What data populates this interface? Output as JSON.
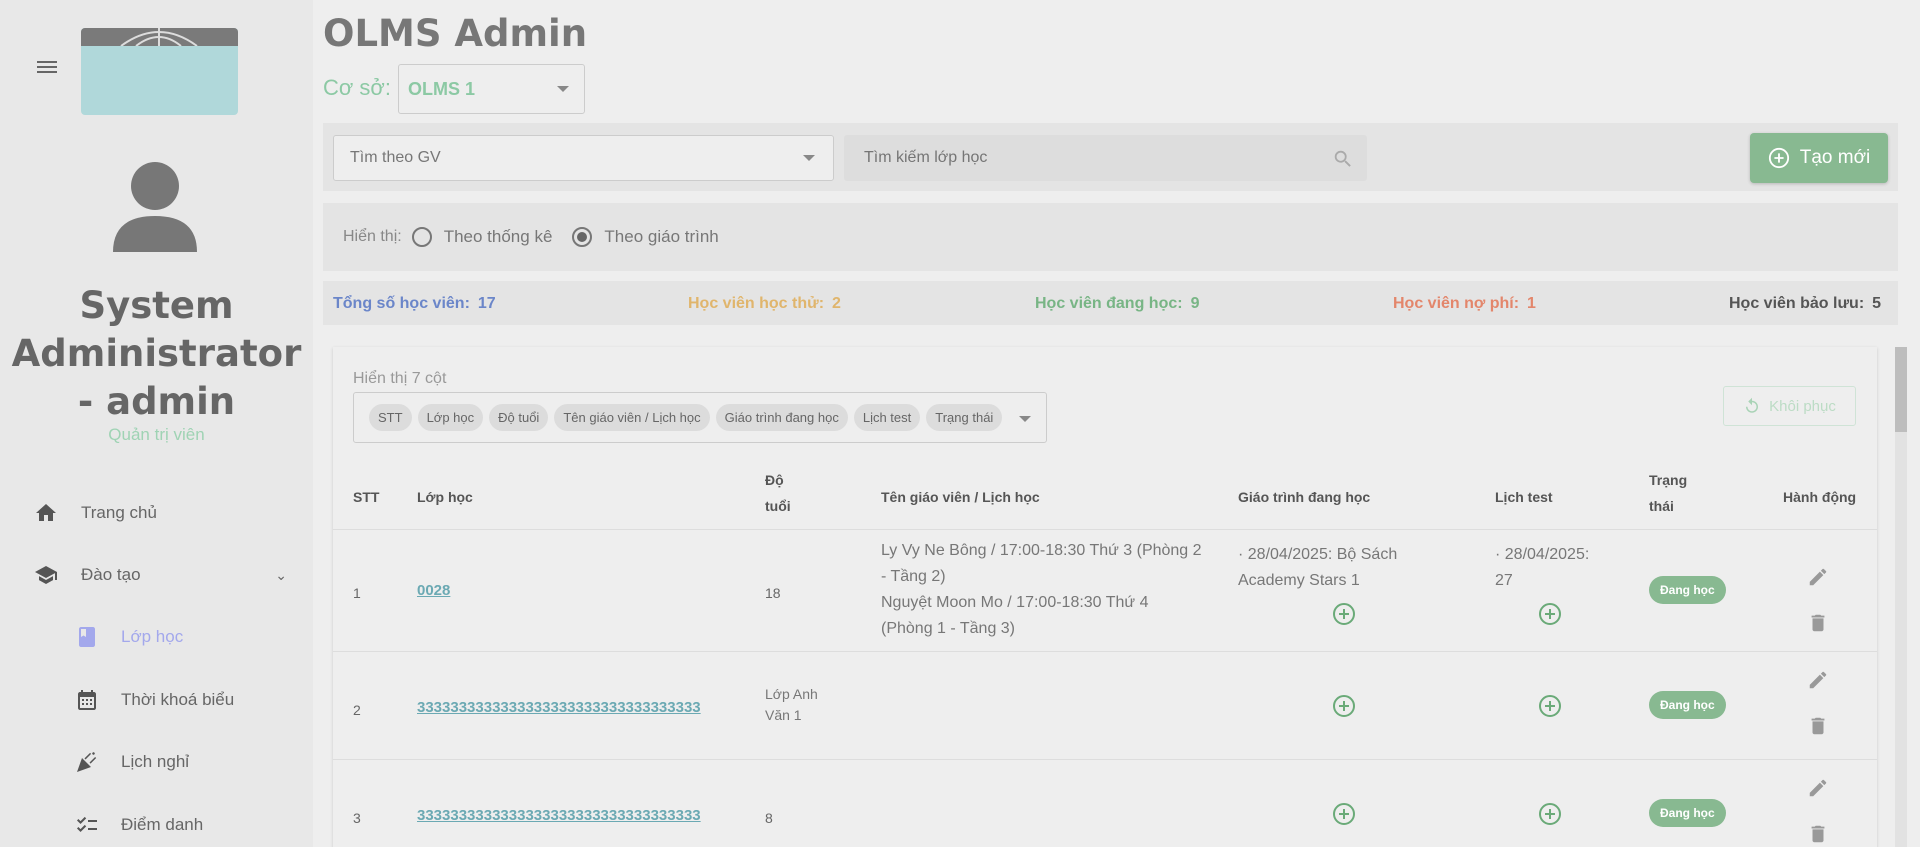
{
  "sidebar": {
    "user_name": "System Administrator - admin",
    "user_role": "Quản trị viên",
    "items": [
      {
        "label": "Trang chủ",
        "icon": "home-icon"
      },
      {
        "label": "Đào tạo",
        "icon": "school-icon"
      },
      {
        "label": "Lớp học",
        "icon": "book-icon"
      },
      {
        "label": "Thời khoá biểu",
        "icon": "calendar-icon"
      },
      {
        "label": "Lịch nghỉ",
        "icon": "party-icon"
      },
      {
        "label": "Điểm danh",
        "icon": "checklist-icon"
      }
    ]
  },
  "header": {
    "title": "OLMS Admin",
    "branch_label": "Cơ sở:",
    "branch_value": "OLMS 1"
  },
  "filters": {
    "teacher_placeholder": "Tìm theo GV",
    "search_placeholder": "Tìm kiếm lớp học",
    "create_label": "Tạo mới"
  },
  "view": {
    "label": "Hiển thị:",
    "option_stats": "Theo thống kê",
    "option_curriculum": "Theo giáo trình",
    "selected": "Theo giáo trình"
  },
  "stats": {
    "total_label": "Tổng số học viên:",
    "total": "17",
    "total_color": "#6b86c9",
    "trial_label": "Học viên học thử:",
    "trial": "2",
    "trial_color": "#e0b56c",
    "studying_label": "Học viên đang học:",
    "studying": "9",
    "studying_color": "#78b585",
    "debt_label": "Học viên nợ phí:",
    "debt": "1",
    "debt_color": "#e3866b",
    "reserved_label": "Học viên bảo lưu:",
    "reserved": "5",
    "reserved_color": "#555555"
  },
  "table": {
    "columns_label": "Hiển thị 7 cột",
    "chips": [
      "STT",
      "Lớp học",
      "Độ tuổi",
      "Tên giáo viên / Lịch học",
      "Giáo trình đang học",
      "Lịch test",
      "Trạng thái"
    ],
    "restore_label": "Khôi phục",
    "headers": {
      "stt": "STT",
      "class": "Lớp học",
      "age_1": "Độ",
      "age_2": "tuổi",
      "teacher": "Tên giáo viên / Lịch học",
      "curriculum": "Giáo trình đang học",
      "test": "Lịch test",
      "status_1": "Trạng",
      "status_2": "thái",
      "action": "Hành động"
    },
    "rows": [
      {
        "stt": "1",
        "class": "0028",
        "age": "18",
        "teacher_1": "Ly Vy Ne Bông / 17:00-18:30 Thứ 3 (Phòng 2",
        "teacher_2": "- Tầng 2)",
        "teacher_3": "Nguyệt Moon Mo / 17:00-18:30 Thứ 4",
        "teacher_4": "(Phòng 1 - Tầng 3)",
        "curriculum_1": "· 28/04/2025: Bộ Sách",
        "curriculum_2": "Academy Stars 1",
        "test_1": "· 28/04/2025:",
        "test_2": "27",
        "status": "Đang học"
      },
      {
        "stt": "2",
        "class": "3333333333333333333333333333333333",
        "age_1": "Lớp Anh",
        "age_2": "Văn 1",
        "status": "Đang học"
      },
      {
        "stt": "3",
        "class": "3333333333333333333333333333333333",
        "age": "8",
        "status": "Đang học"
      }
    ]
  }
}
